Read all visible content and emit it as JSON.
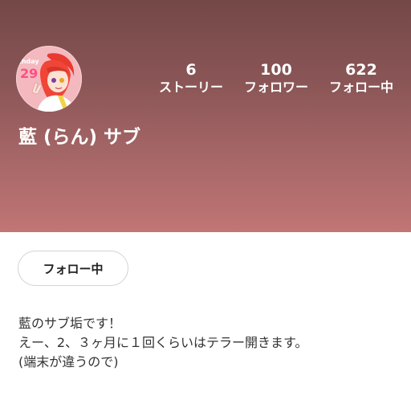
{
  "profile": {
    "display_name": "藍 (らん) サブ",
    "avatar_text": "thday 29"
  },
  "stats": {
    "stories": {
      "count": "6",
      "label": "ストーリー"
    },
    "followers": {
      "count": "100",
      "label": "フォロワー"
    },
    "following": {
      "count": "622",
      "label": "フォロー中"
    }
  },
  "actions": {
    "follow_label": "フォロー中"
  },
  "bio": {
    "lines": [
      "藍のサブ垢です！",
      "えー、2、３ヶ月に１回くらいはテラー開きます。",
      "(端末が違うので)"
    ]
  },
  "colors": {
    "header_top": "#744847",
    "header_bottom": "#c07675",
    "text_on_header": "#ffffff",
    "button_border": "#d3d3d3"
  }
}
